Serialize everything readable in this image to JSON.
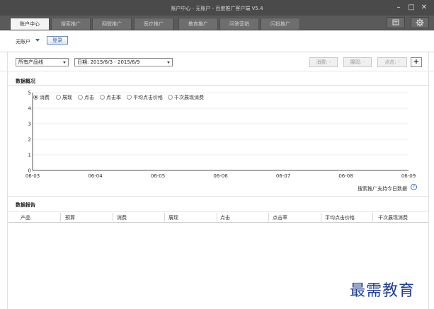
{
  "window": {
    "title": "账户中心 - 无账户 - 百度推广客户端 V5.4",
    "minimize": "–",
    "maximize": "□",
    "close": "✕"
  },
  "tabs": [
    {
      "label": "账户中心",
      "active": true
    },
    {
      "label": "搜索推广",
      "active": false
    },
    {
      "label": "网盟推广",
      "active": false
    },
    {
      "label": "医疗推广",
      "active": false
    },
    {
      "label": "教育推广",
      "active": false
    },
    {
      "label": "问答营销",
      "active": false
    },
    {
      "label": "闪投推广",
      "active": false
    }
  ],
  "tab_icons": [
    "message-icon",
    "gear-icon"
  ],
  "account": {
    "label": "无账户",
    "login_button": "登录"
  },
  "filters": {
    "product_line": "所有产品线",
    "date_range": "日期: 2015/6/3 - 2015/6/9",
    "metrics": [
      "消费: -",
      "展现: -",
      "点击: -"
    ],
    "add_button": "+"
  },
  "overview": {
    "heading": "数据概况",
    "legend": [
      {
        "label": "消费",
        "selected": true
      },
      {
        "label": "展现",
        "selected": false
      },
      {
        "label": "点击",
        "selected": false
      },
      {
        "label": "点击率",
        "selected": false
      },
      {
        "label": "平均点击价格",
        "selected": false
      },
      {
        "label": "千次展现消费",
        "selected": false
      }
    ],
    "note": "搜索推广支持今日数据",
    "help_icon": "?"
  },
  "chart_data": {
    "type": "line",
    "categories": [
      "06-03",
      "06-04",
      "06-05",
      "06-06",
      "06-07",
      "06-08",
      "06-09"
    ],
    "series": [],
    "y_ticks": [
      "0",
      "1",
      "2",
      "3",
      "4",
      "5"
    ],
    "ylim": [
      0,
      5
    ],
    "grid": true
  },
  "report": {
    "heading": "数据报告",
    "columns": [
      "产品",
      "预算",
      "消费",
      "展现",
      "点击",
      "点击率",
      "平均点击价格",
      "千次展现消费"
    ],
    "rows": []
  },
  "watermark": "最需教育",
  "colors": {
    "titlebar": "#4a4a4a",
    "tabbar": "#5a5a5a",
    "active_tab": "#f4f4f4",
    "accent_blue": "#2a6fc9",
    "watermark": "#1f3f93"
  }
}
